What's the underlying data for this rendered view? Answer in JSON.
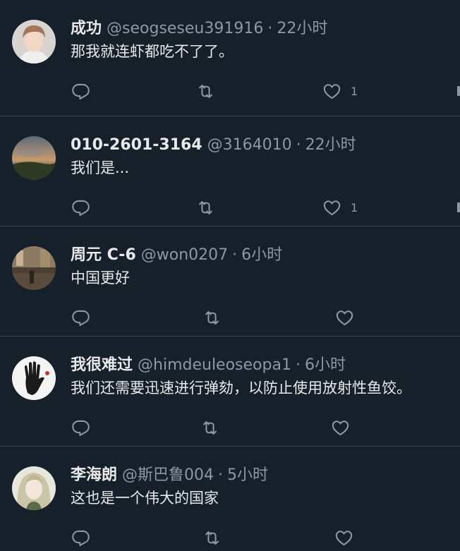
{
  "tweets": [
    {
      "name": "成功",
      "handle": "@seogseseu391916",
      "dot": "·",
      "time": "22小时",
      "text": "那我就连虾都吃不了了。",
      "like_count": "1",
      "avatar": "person-portrait"
    },
    {
      "name": "010-2601-3164",
      "handle": "@3164010",
      "dot": "·",
      "time": "22小时",
      "text": "我们是...",
      "like_count": "1",
      "avatar": "sunset-landscape"
    },
    {
      "name": "周元 C-6",
      "handle": "@won0207",
      "dot": "·",
      "time": "6小时",
      "text": "中国更好",
      "like_count": "",
      "avatar": "street-scene"
    },
    {
      "name": "我很难过",
      "handle": "@himdeuleoseopa1",
      "dot": "·",
      "time": "6小时",
      "text": "我们还需要迅速进行弹劾，以防止使用放射性鱼饺。",
      "like_count": "",
      "avatar": "handprint-art"
    },
    {
      "name": "李海朗",
      "handle": "@斯巴鲁004",
      "dot": "·",
      "time": "5小时",
      "text": "这也是一个伟大的国家",
      "like_count": "",
      "avatar": "anime-character"
    }
  ],
  "icons": {
    "reply": "reply-icon",
    "retweet": "retweet-icon",
    "like": "like-icon"
  },
  "colors": {
    "background": "#15202b",
    "divider": "#38444d",
    "primary_text": "#e7e9ea",
    "secondary_text": "#8b98a5"
  }
}
